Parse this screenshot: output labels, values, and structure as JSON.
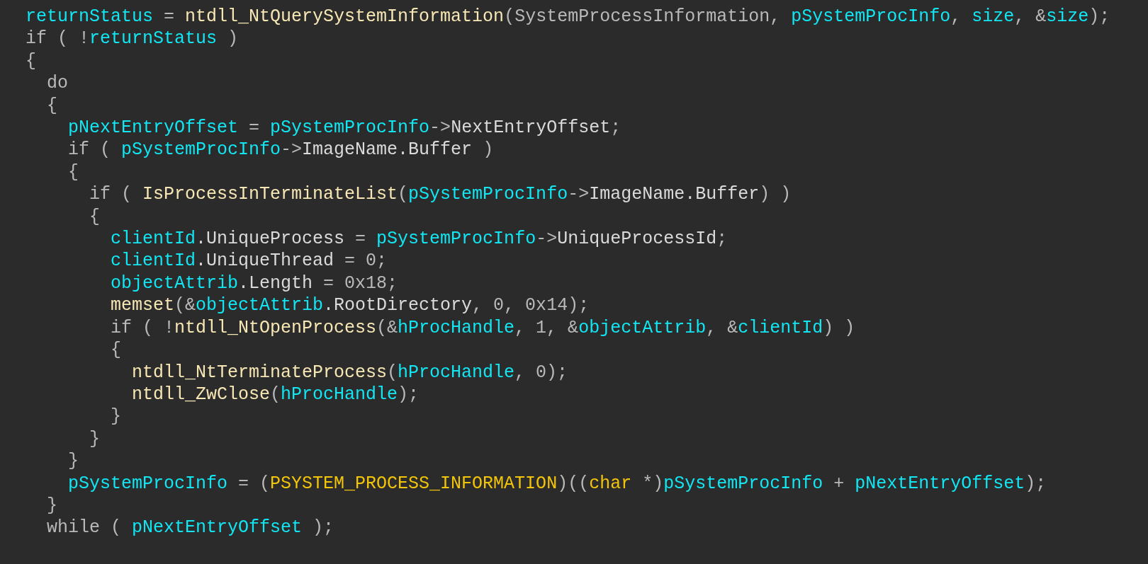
{
  "code": {
    "lines": [
      {
        "tokens": [
          {
            "text": "returnStatus",
            "kind": "variable"
          },
          {
            "text": " = ",
            "kind": "plain"
          },
          {
            "text": "ntdll_NtQuerySystemInformation",
            "kind": "function"
          },
          {
            "text": "(SystemProcessInformation, ",
            "kind": "plain"
          },
          {
            "text": "pSystemProcInfo",
            "kind": "variable"
          },
          {
            "text": ", ",
            "kind": "plain"
          },
          {
            "text": "size",
            "kind": "variable"
          },
          {
            "text": ", &",
            "kind": "plain"
          },
          {
            "text": "size",
            "kind": "variable"
          },
          {
            "text": ");",
            "kind": "plain"
          }
        ]
      },
      {
        "tokens": [
          {
            "text": "if ( !",
            "kind": "plain"
          },
          {
            "text": "returnStatus",
            "kind": "variable"
          },
          {
            "text": " )",
            "kind": "plain"
          }
        ]
      },
      {
        "tokens": [
          {
            "text": "{",
            "kind": "plain"
          }
        ],
        "children": [
          {
            "tokens": [
              {
                "text": "do",
                "kind": "plain"
              }
            ]
          },
          {
            "tokens": [
              {
                "text": "{",
                "kind": "plain"
              }
            ],
            "children": [
              {
                "tokens": [
                  {
                    "text": "pNextEntryOffset",
                    "kind": "variable"
                  },
                  {
                    "text": " = ",
                    "kind": "plain"
                  },
                  {
                    "text": "pSystemProcInfo",
                    "kind": "variable"
                  },
                  {
                    "text": "->",
                    "kind": "plain"
                  },
                  {
                    "text": "NextEntryOffset",
                    "kind": "member"
                  },
                  {
                    "text": ";",
                    "kind": "plain"
                  }
                ]
              },
              {
                "tokens": [
                  {
                    "text": "if ( ",
                    "kind": "plain"
                  },
                  {
                    "text": "pSystemProcInfo",
                    "kind": "variable"
                  },
                  {
                    "text": "->",
                    "kind": "plain"
                  },
                  {
                    "text": "ImageName.Buffer",
                    "kind": "member"
                  },
                  {
                    "text": " )",
                    "kind": "plain"
                  }
                ]
              },
              {
                "tokens": [
                  {
                    "text": "{",
                    "kind": "plain"
                  }
                ],
                "children": [
                  {
                    "tokens": [
                      {
                        "text": "if ( ",
                        "kind": "plain"
                      },
                      {
                        "text": "IsProcessInTerminateList",
                        "kind": "function"
                      },
                      {
                        "text": "(",
                        "kind": "plain"
                      },
                      {
                        "text": "pSystemProcInfo",
                        "kind": "variable"
                      },
                      {
                        "text": "->",
                        "kind": "plain"
                      },
                      {
                        "text": "ImageName.Buffer",
                        "kind": "member"
                      },
                      {
                        "text": ") )",
                        "kind": "plain"
                      }
                    ]
                  },
                  {
                    "tokens": [
                      {
                        "text": "{",
                        "kind": "plain"
                      }
                    ],
                    "children": [
                      {
                        "tokens": [
                          {
                            "text": "clientId",
                            "kind": "variable"
                          },
                          {
                            "text": ".UniqueProcess",
                            "kind": "member"
                          },
                          {
                            "text": " = ",
                            "kind": "plain"
                          },
                          {
                            "text": "pSystemProcInfo",
                            "kind": "variable"
                          },
                          {
                            "text": "->",
                            "kind": "plain"
                          },
                          {
                            "text": "UniqueProcessId",
                            "kind": "member"
                          },
                          {
                            "text": ";",
                            "kind": "plain"
                          }
                        ]
                      },
                      {
                        "tokens": [
                          {
                            "text": "clientId",
                            "kind": "variable"
                          },
                          {
                            "text": ".UniqueThread",
                            "kind": "member"
                          },
                          {
                            "text": " = 0;",
                            "kind": "plain"
                          }
                        ]
                      },
                      {
                        "tokens": [
                          {
                            "text": "objectAttrib",
                            "kind": "variable"
                          },
                          {
                            "text": ".Length",
                            "kind": "member"
                          },
                          {
                            "text": " = 0x18;",
                            "kind": "plain"
                          }
                        ]
                      },
                      {
                        "tokens": [
                          {
                            "text": "memset",
                            "kind": "function"
                          },
                          {
                            "text": "(&",
                            "kind": "plain"
                          },
                          {
                            "text": "objectAttrib",
                            "kind": "variable"
                          },
                          {
                            "text": ".RootDirectory",
                            "kind": "member"
                          },
                          {
                            "text": ", 0, 0x14);",
                            "kind": "plain"
                          }
                        ]
                      },
                      {
                        "tokens": [
                          {
                            "text": "if ( !",
                            "kind": "plain"
                          },
                          {
                            "text": "ntdll_NtOpenProcess",
                            "kind": "function"
                          },
                          {
                            "text": "(&",
                            "kind": "plain"
                          },
                          {
                            "text": "hProcHandle",
                            "kind": "variable"
                          },
                          {
                            "text": ", 1, &",
                            "kind": "plain"
                          },
                          {
                            "text": "objectAttrib",
                            "kind": "variable"
                          },
                          {
                            "text": ", &",
                            "kind": "plain"
                          },
                          {
                            "text": "clientId",
                            "kind": "variable"
                          },
                          {
                            "text": ") )",
                            "kind": "plain"
                          }
                        ]
                      },
                      {
                        "tokens": [
                          {
                            "text": "{",
                            "kind": "plain"
                          }
                        ],
                        "children": [
                          {
                            "tokens": [
                              {
                                "text": "ntdll_NtTerminateProcess",
                                "kind": "function"
                              },
                              {
                                "text": "(",
                                "kind": "plain"
                              },
                              {
                                "text": "hProcHandle",
                                "kind": "variable"
                              },
                              {
                                "text": ", 0);",
                                "kind": "plain"
                              }
                            ]
                          },
                          {
                            "tokens": [
                              {
                                "text": "ntdll_ZwClose",
                                "kind": "function"
                              },
                              {
                                "text": "(",
                                "kind": "plain"
                              },
                              {
                                "text": "hProcHandle",
                                "kind": "variable"
                              },
                              {
                                "text": ");",
                                "kind": "plain"
                              }
                            ]
                          }
                        ]
                      },
                      {
                        "tokens": [
                          {
                            "text": "}",
                            "kind": "plain"
                          }
                        ]
                      }
                    ]
                  },
                  {
                    "tokens": [
                      {
                        "text": "}",
                        "kind": "plain"
                      }
                    ]
                  }
                ]
              },
              {
                "tokens": [
                  {
                    "text": "}",
                    "kind": "plain"
                  }
                ]
              },
              {
                "tokens": [
                  {
                    "text": "pSystemProcInfo",
                    "kind": "variable"
                  },
                  {
                    "text": " = (",
                    "kind": "plain"
                  },
                  {
                    "text": "PSYSTEM_PROCESS_INFORMATION",
                    "kind": "type"
                  },
                  {
                    "text": ")((",
                    "kind": "plain"
                  },
                  {
                    "text": "char",
                    "kind": "type"
                  },
                  {
                    "text": " *)",
                    "kind": "plain"
                  },
                  {
                    "text": "pSystemProcInfo",
                    "kind": "variable"
                  },
                  {
                    "text": " + ",
                    "kind": "plain"
                  },
                  {
                    "text": "pNextEntryOffset",
                    "kind": "variable"
                  },
                  {
                    "text": ");",
                    "kind": "plain"
                  }
                ]
              }
            ]
          },
          {
            "tokens": [
              {
                "text": "}",
                "kind": "plain"
              }
            ]
          },
          {
            "tokens": [
              {
                "text": "while ( ",
                "kind": "plain"
              },
              {
                "text": "pNextEntryOffset",
                "kind": "variable"
              },
              {
                "text": " );",
                "kind": "plain"
              }
            ]
          }
        ]
      }
    ]
  }
}
